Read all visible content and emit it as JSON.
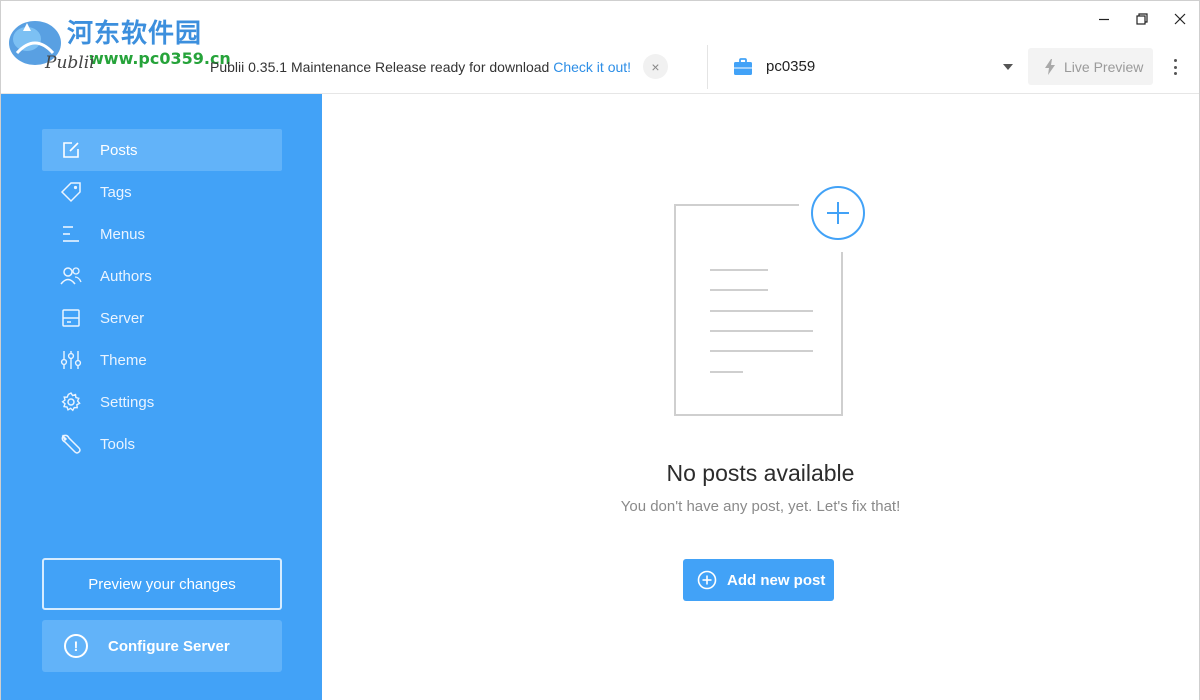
{
  "window": {
    "minimize": "minimize",
    "maximize": "restore",
    "close": "close"
  },
  "branding": {
    "watermark_cn": "河东软件园",
    "watermark_url": "www.pc0359.cn",
    "app_logo_text": "Publii"
  },
  "notice": {
    "text": "Publii 0.35.1 Maintenance Release ready for download",
    "link": "Check it out!",
    "close": "×"
  },
  "site": {
    "name": "pc0359",
    "icon": "briefcase-icon"
  },
  "live_preview": {
    "label": "Live Preview",
    "icon": "bolt-icon"
  },
  "sidebar": {
    "items": [
      {
        "label": "Posts",
        "icon": "edit-icon",
        "active": true
      },
      {
        "label": "Tags",
        "icon": "tag-icon",
        "active": false
      },
      {
        "label": "Menus",
        "icon": "menu-icon",
        "active": false
      },
      {
        "label": "Authors",
        "icon": "authors-icon",
        "active": false
      },
      {
        "label": "Server",
        "icon": "server-icon",
        "active": false
      },
      {
        "label": "Theme",
        "icon": "sliders-icon",
        "active": false
      },
      {
        "label": "Settings",
        "icon": "gear-icon",
        "active": false
      },
      {
        "label": "Tools",
        "icon": "wrench-icon",
        "active": false
      }
    ],
    "preview_button": "Preview your changes",
    "configure_button": "Configure Server",
    "configure_icon_glyph": "!"
  },
  "main": {
    "empty_title": "No posts available",
    "empty_subtitle": "You don't have any post, yet. Let's fix that!",
    "add_button": "Add new post"
  },
  "colors": {
    "accent": "#42a2f7",
    "accent_light": "#62b3f9",
    "link": "#2d8ee6"
  }
}
